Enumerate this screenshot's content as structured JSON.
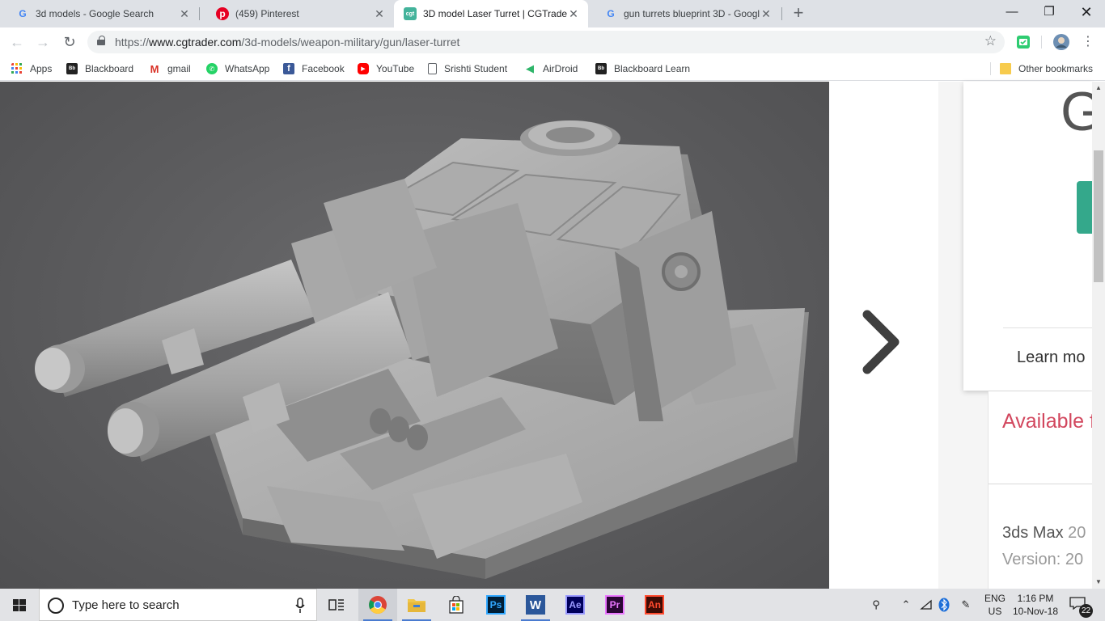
{
  "tabs": [
    {
      "title": "3d models - Google Search",
      "favicon": "google-g-icon",
      "active": false
    },
    {
      "title": "(459) Pinterest",
      "favicon": "pinterest-icon",
      "active": false
    },
    {
      "title": "3D model Laser Turret | CGTrader",
      "favicon": "cgtrader-icon",
      "favicon_text": "cgt",
      "active": true
    },
    {
      "title": "gun turrets blueprint 3D - Googl",
      "favicon": "google-g-icon",
      "active": false
    }
  ],
  "address": {
    "scheme": "https://",
    "host": "www.cgtrader.com",
    "path": "/3d-models/weapon-military/gun/laser-turret"
  },
  "bookmarks": [
    {
      "label": "Apps",
      "icon": "apps-grid-icon"
    },
    {
      "label": "Blackboard",
      "icon": "blackboard-icon"
    },
    {
      "label": "gmail",
      "icon": "gmail-icon"
    },
    {
      "label": "WhatsApp",
      "icon": "whatsapp-icon"
    },
    {
      "label": "Facebook",
      "icon": "facebook-icon"
    },
    {
      "label": "YouTube",
      "icon": "youtube-icon"
    },
    {
      "label": "Srishti Student",
      "icon": "page-icon"
    },
    {
      "label": "AirDroid",
      "icon": "airdroid-icon"
    },
    {
      "label": "Blackboard Learn",
      "icon": "blackboard-icon"
    }
  ],
  "other_bookmarks": "Other bookmarks",
  "page": {
    "viewer_image": "3D render of twin-barrel laser turret on square base",
    "sidebar_logo_letter": "G",
    "learn_more": "Learn mo",
    "available_for": "Available f",
    "software": {
      "name": "3ds Max",
      "name_year": "20",
      "version_label": "Version:",
      "version_value": "20"
    }
  },
  "taskbar": {
    "search_placeholder": "Type here to search",
    "apps": [
      {
        "name": "chrome",
        "label": ""
      },
      {
        "name": "file-explorer",
        "label": ""
      },
      {
        "name": "store",
        "label": ""
      },
      {
        "name": "photoshop",
        "label": "Ps"
      },
      {
        "name": "word",
        "label": "W"
      },
      {
        "name": "after-effects",
        "label": "Ae"
      },
      {
        "name": "premiere",
        "label": "Pr"
      },
      {
        "name": "animate",
        "label": "An"
      }
    ],
    "lang_top": "ENG",
    "lang_bottom": "US",
    "time": "1:16 PM",
    "date": "10-Nov-18",
    "notifications": "22"
  },
  "colors": {
    "accent_green": "#34a88b",
    "available_red": "#d2475e",
    "tab_strip": "#dee1e6",
    "taskbar": "#e2e3e6"
  }
}
